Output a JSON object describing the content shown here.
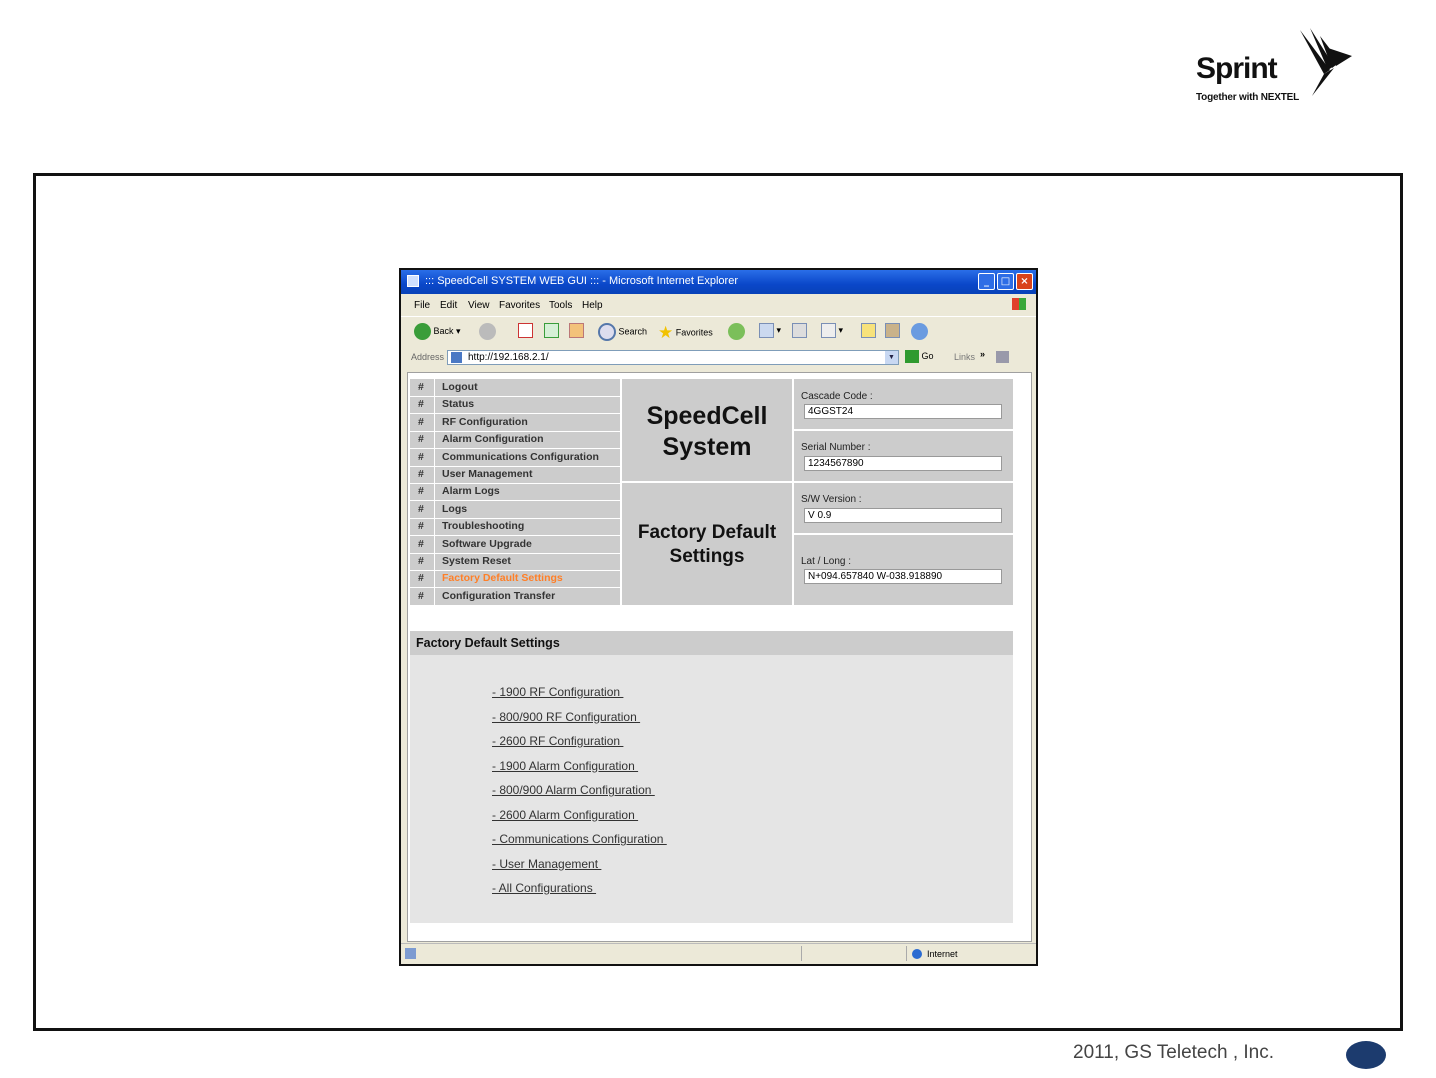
{
  "brand": {
    "name": "Sprint",
    "tagline": "Together with NEXTEL"
  },
  "footer": {
    "copyright": "2011, GS Teletech , Inc."
  },
  "browser": {
    "title": "::: SpeedCell SYSTEM WEB GUI ::: - Microsoft Internet Explorer",
    "menu": [
      "File",
      "Edit",
      "View",
      "Favorites",
      "Tools",
      "Help"
    ],
    "toolbar": {
      "back": "Back",
      "search": "Search",
      "favorites": "Favorites"
    },
    "address_label": "Address",
    "address_value": "http://192.168.2.1/",
    "go_label": "Go",
    "links_label": "Links",
    "status_zone": "Internet"
  },
  "nav": {
    "bullet": "#",
    "items": [
      "Logout",
      "Status",
      "RF Configuration",
      "Alarm Configuration",
      "Communications Configuration",
      "User Management",
      "Alarm Logs",
      "Logs",
      "Troubleshooting",
      "Software Upgrade",
      "System Reset",
      "Factory Default Settings",
      "Configuration Transfer"
    ],
    "active_index": 11
  },
  "system": {
    "line1": "SpeedCell",
    "line2": "System"
  },
  "page": {
    "line1": "Factory Default",
    "line2": "Settings"
  },
  "info": {
    "cascade_label": "Cascade Code :",
    "cascade_value": "4GGST24",
    "serial_label": "Serial Number :",
    "serial_value": "1234567890",
    "sw_label": "S/W Version :",
    "sw_value": "V 0.9",
    "latlong_label": "Lat / Long :",
    "latlong_value": "N+094.657840 W-038.918890"
  },
  "factory": {
    "heading": "Factory Default Settings",
    "links": [
      "- 1900 RF Configuration ",
      "- 800/900 RF Configuration ",
      "- 2600 RF Configuration ",
      "- 1900 Alarm Configuration ",
      "- 800/900 Alarm Configuration ",
      "- 2600 Alarm Configuration ",
      "- Communications Configuration ",
      "- User Management ",
      "- All Configurations "
    ]
  },
  "colors": {
    "active_nav": "#ff7f27",
    "panel": "#cccccc",
    "titlebar": "#0a47c9",
    "frame": "#111111"
  }
}
